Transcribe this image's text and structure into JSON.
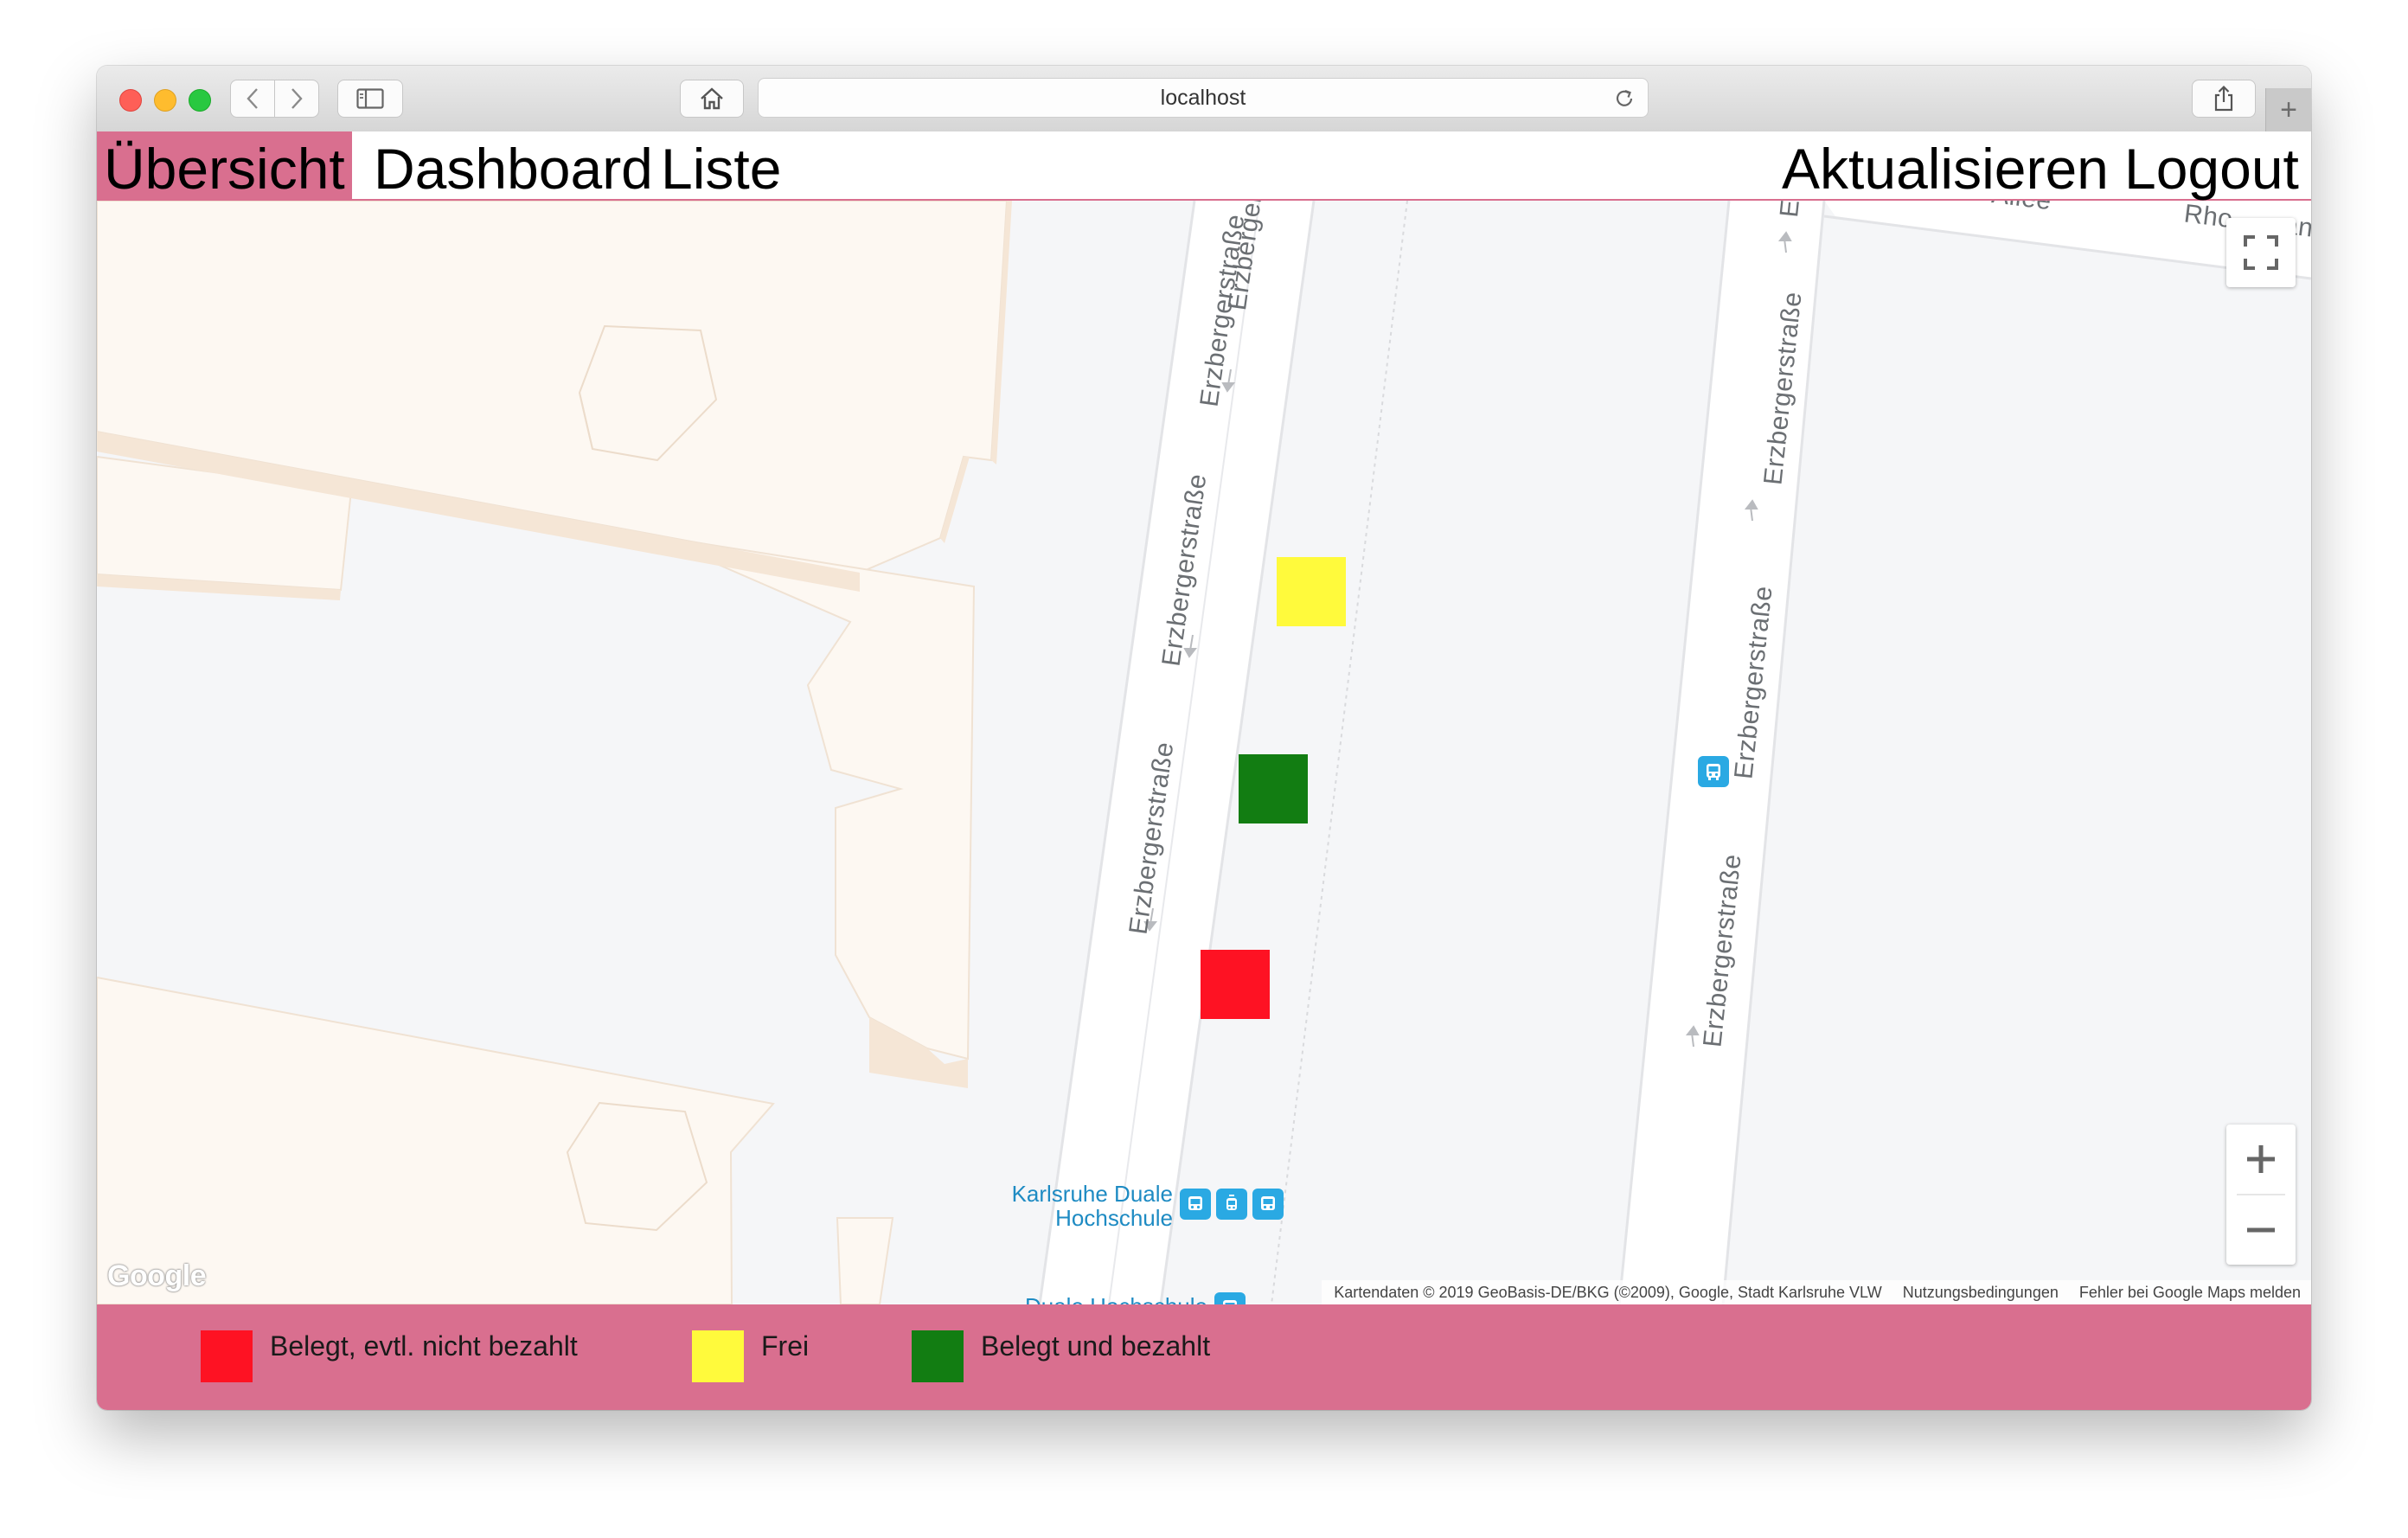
{
  "browser": {
    "url": "localhost",
    "new_tab_symbol": "+"
  },
  "nav": {
    "left": [
      "Übersicht",
      "Dashboard",
      "Liste"
    ],
    "right": [
      "Aktualisieren",
      "Logout"
    ],
    "active": "Übersicht",
    "accent_color": "#d96f8f"
  },
  "map": {
    "street_name": "Erzbergerstraße",
    "street_name_partial": "Erzbergerst",
    "street_name_stub": "E",
    "allee_partial": "-Allee",
    "rho_partial": "Rho",
    "an_partial": "an",
    "poi": [
      {
        "label_line1": "Karlsruhe Duale",
        "label_line2": "Hochschule",
        "icon": "tram-icon"
      },
      {
        "label_line1": "Duale Hochschule",
        "label_line2": "",
        "icon": "bus-icon"
      }
    ],
    "parking_spots": [
      {
        "status": "Frei",
        "color": "#fffa3c"
      },
      {
        "status": "Belegt und bezahlt",
        "color": "#127d12"
      },
      {
        "status": "Belegt, evtl. nicht bezahlt",
        "color": "#fe1223"
      }
    ],
    "google_logo": "Google",
    "attribution": {
      "data": "Kartendaten © 2019 GeoBasis-DE/BKG (©2009), Google, Stadt Karlsruhe VLW",
      "terms": "Nutzungsbedingungen",
      "report": "Fehler bei Google Maps melden"
    },
    "controls": [
      "fullscreen-icon",
      "zoom-in-icon",
      "zoom-out-icon"
    ]
  },
  "legend": [
    {
      "label": "Belegt, evtl. nicht bezahlt",
      "color": "#fe1223"
    },
    {
      "label": "Frei",
      "color": "#fffa3c"
    },
    {
      "label": "Belegt und bezahlt",
      "color": "#127d12"
    }
  ]
}
